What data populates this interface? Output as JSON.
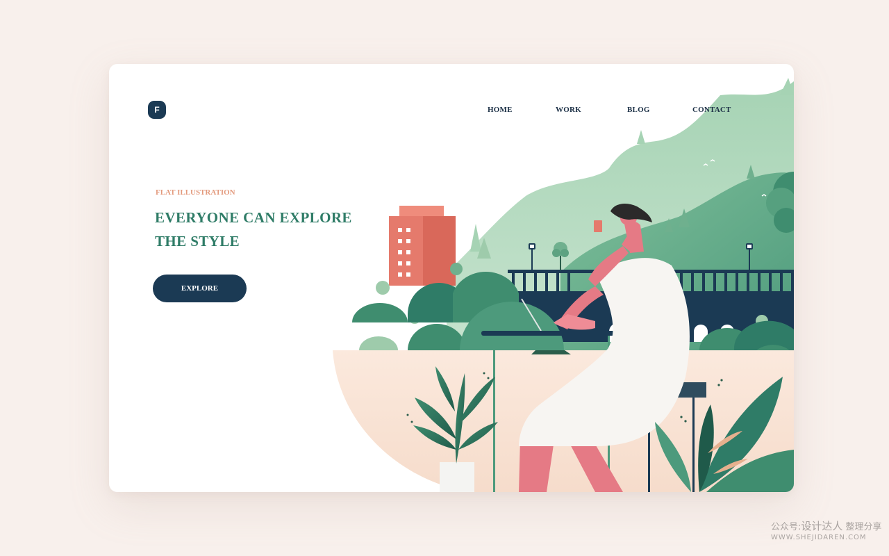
{
  "logo": {
    "letter": "F"
  },
  "nav": {
    "items": [
      {
        "label": "HOME"
      },
      {
        "label": "WORK"
      },
      {
        "label": "BLOG"
      },
      {
        "label": "CONTACT"
      }
    ]
  },
  "hero": {
    "eyebrow": "FLAT ILLUSTRATION",
    "headline_line1": "EVERYONE CAN EXPLORE",
    "headline_line2": "THE STYLE",
    "cta_label": "EXPLORE"
  },
  "watermark": {
    "prefix": "公众号:",
    "brand": "设计达人",
    "suffix": "整理分享",
    "url": "WWW.SHEJIDAREN.COM"
  },
  "colors": {
    "page_bg": "#f8f0ec",
    "navy": "#1b3a54",
    "teal": "#2f7c67",
    "coral": "#e39a7d",
    "mint": "#b9dcc3",
    "peach": "#f9e3d6",
    "building": "#e57a6c"
  }
}
